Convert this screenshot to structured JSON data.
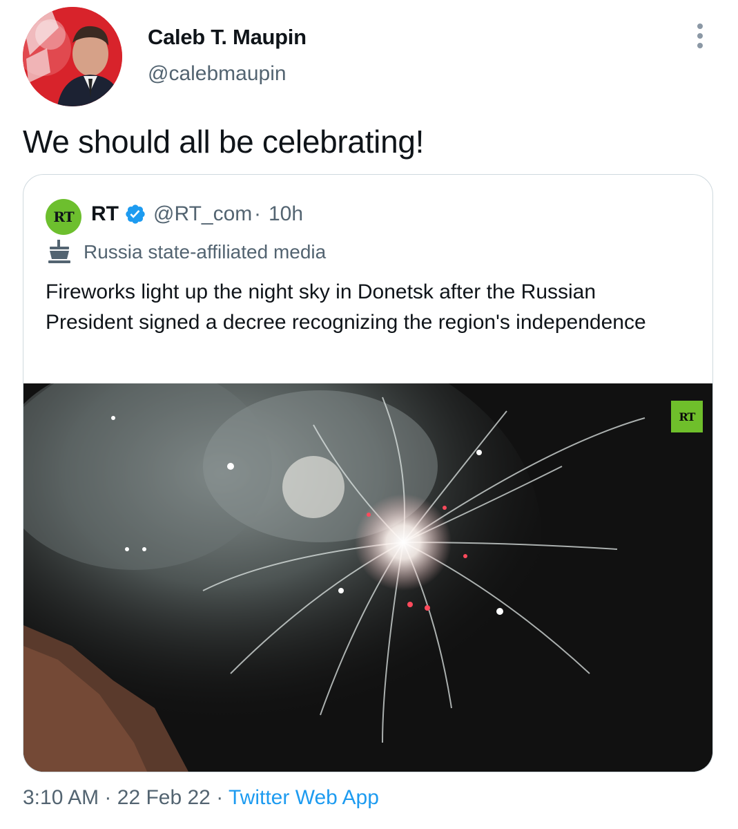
{
  "tweet": {
    "author_name": "Caleb T. Maupin",
    "author_handle": "@calebmaupin",
    "text": "We should all be celebrating!",
    "timestamp": "3:10 AM",
    "date": "22 Feb 22",
    "separator": "·",
    "source": "Twitter Web App"
  },
  "quoted_tweet": {
    "avatar_text": "RT",
    "author_name": "RT",
    "verified": true,
    "author_handle": "@RT_com",
    "separator": "·",
    "time_ago": "10h",
    "label": "Russia state-affiliated media",
    "text": "Fireworks light up the night sky in Donetsk after the Russian President signed a decree recognizing the region's independence",
    "media_watermark": "RT"
  },
  "colors": {
    "text_primary": "#0f1419",
    "text_secondary": "#536471",
    "link": "#1d9bf0",
    "verified_badge": "#1d9bf0",
    "rt_brand_green": "#6fbf2b",
    "card_border": "#cfd9de"
  },
  "icons": {
    "more": "more-options-icon",
    "verified": "verified-badge-icon",
    "state_media": "state-media-label-icon"
  }
}
